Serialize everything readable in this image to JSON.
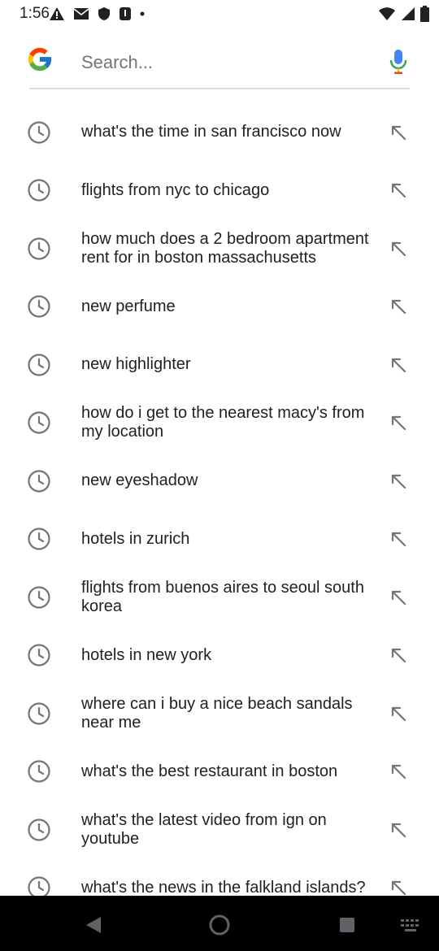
{
  "status_bar": {
    "time": "1:56",
    "left_icons": [
      "alert-icon",
      "mail-icon",
      "shield-icon",
      "app-icon",
      "dot-icon"
    ],
    "right_icons": [
      "wifi-icon",
      "signal-icon",
      "battery-icon"
    ]
  },
  "search": {
    "placeholder": "Search...",
    "value": ""
  },
  "suggestions": [
    {
      "text": "what's the time in san francisco now"
    },
    {
      "text": "flights from nyc to chicago"
    },
    {
      "text": "how much does a 2 bedroom apartment rent for in boston massachusetts"
    },
    {
      "text": "new perfume"
    },
    {
      "text": "new highlighter"
    },
    {
      "text": "how do i get to the nearest macy's from my location"
    },
    {
      "text": "new eyeshadow"
    },
    {
      "text": "hotels in zurich"
    },
    {
      "text": "flights from buenos aires to seoul south korea"
    },
    {
      "text": "hotels in new york"
    },
    {
      "text": "where can i buy a nice beach sandals near me"
    },
    {
      "text": "what's the best restaurant in boston"
    },
    {
      "text": "what's the latest video from ign on youtube"
    },
    {
      "text": "what's the news in the falkland islands?"
    }
  ],
  "colors": {
    "text": "#202124",
    "icon_gray": "#70757a",
    "divider": "#dadce0",
    "nav_bg": "#000000"
  }
}
